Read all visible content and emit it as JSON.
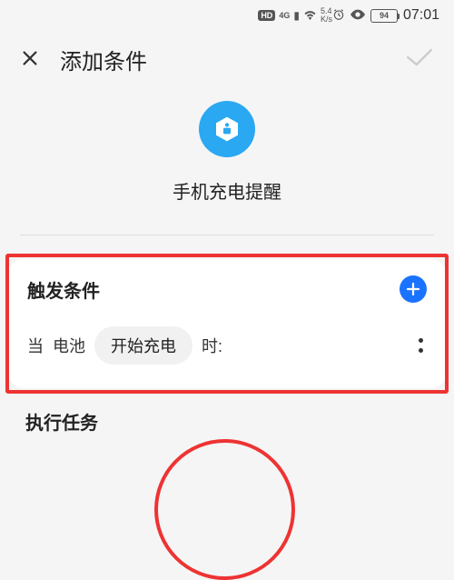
{
  "statusbar": {
    "hd": "HD",
    "net": "4G",
    "speed_top": "5.4",
    "speed_bot": "K/s",
    "battery": "94",
    "time": "07:01"
  },
  "header": {
    "title": "添加条件"
  },
  "hero": {
    "title": "手机充电提醒"
  },
  "trigger": {
    "title": "触发条件",
    "when": "当",
    "battery": "电池",
    "start_charge": "开始充电",
    "shi": "时:"
  },
  "tasks": {
    "title": "执行任务"
  }
}
